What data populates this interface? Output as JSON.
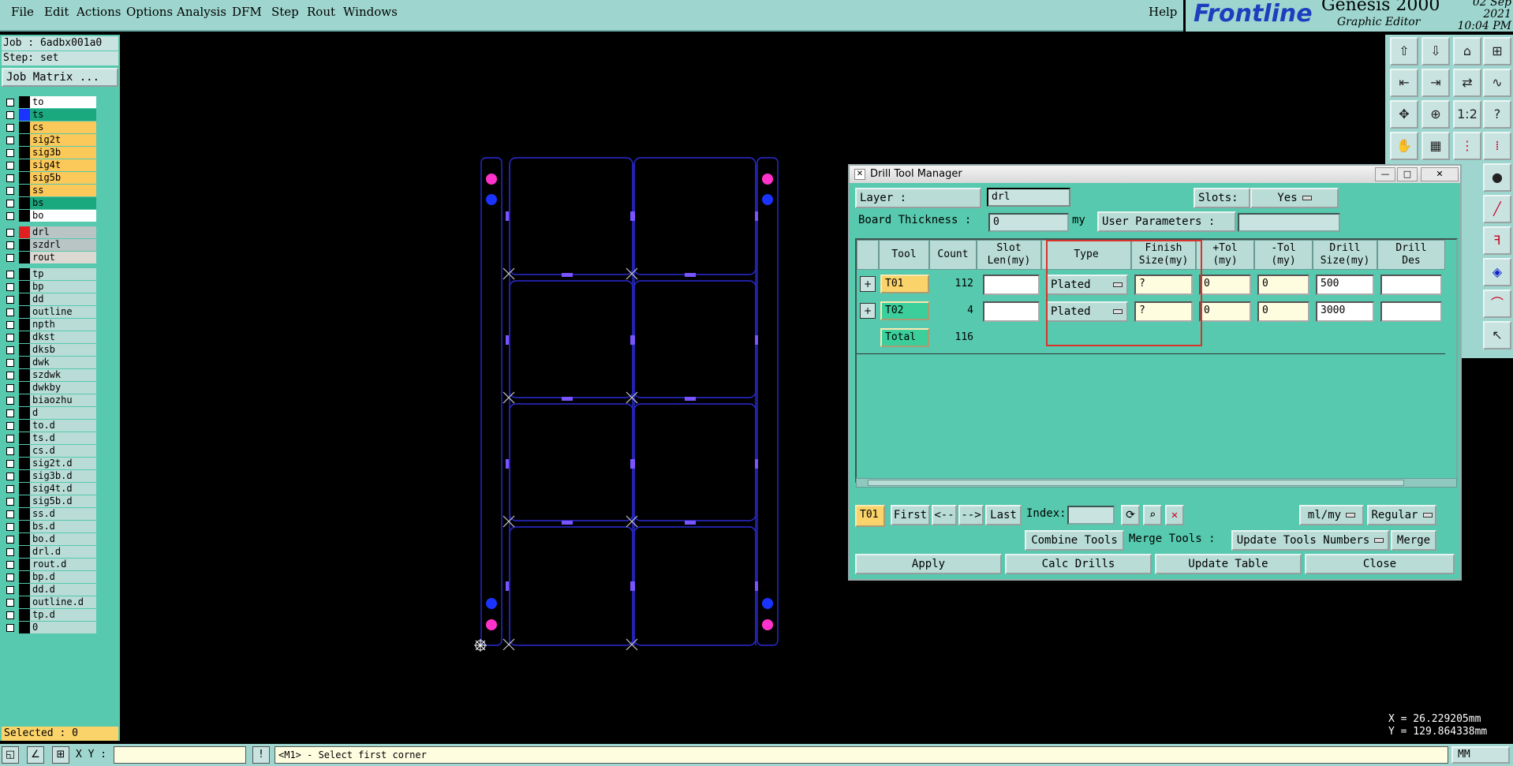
{
  "menu": [
    "File",
    "Edit",
    "Actions",
    "Options",
    "Analysis",
    "DFM",
    "Step",
    "Rout",
    "Windows"
  ],
  "help": "Help",
  "brand": {
    "logo": "Frontline",
    "product": "Genesis 2000",
    "subtitle": "Graphic Editor",
    "date": "02 Sep 2021",
    "time": "10:04 PM"
  },
  "left": {
    "job": "Job : 6adbx001a0",
    "step": "Step: set",
    "job_matrix": "Job Matrix ...",
    "layers_board": [
      {
        "name": "to",
        "color": "#ffffff"
      },
      {
        "name": "ts",
        "color": "#1aa87e"
      },
      {
        "name": "cs",
        "color": "#fbc85a"
      },
      {
        "name": "sig2t",
        "color": "#fbc85a"
      },
      {
        "name": "sig3b",
        "color": "#fbc85a"
      },
      {
        "name": "sig4t",
        "color": "#fbc85a"
      },
      {
        "name": "sig5b",
        "color": "#fbc85a"
      },
      {
        "name": "ss",
        "color": "#fbc85a"
      },
      {
        "name": "bs",
        "color": "#1aa87e"
      },
      {
        "name": "bo",
        "color": "#ffffff"
      }
    ],
    "layers_drill": [
      {
        "name": "drl",
        "color": "#b9c4c4"
      },
      {
        "name": "szdrl",
        "color": "#b9c4c4"
      },
      {
        "name": "rout",
        "color": "#dcd8d2"
      }
    ],
    "layers_misc": [
      "tp",
      "bp",
      "dd",
      "outline",
      "npth",
      "dkst",
      "dksb",
      "dwk",
      "szdwk",
      "dwkby",
      "biaozhu",
      "d",
      "to.d",
      "ts.d",
      "cs.d",
      "sig2t.d",
      "sig3b.d",
      "sig4t.d",
      "sig5b.d",
      "ss.d",
      "bs.d",
      "bo.d",
      "drl.d",
      "rout.d",
      "bp.d",
      "dd.d",
      "outline.d",
      "tp.d",
      "0"
    ],
    "selected": "Selected : 0"
  },
  "right_tools": [
    "up-arrow-icon",
    "down-arrow-icon",
    "home-icon",
    "grid-icon",
    "left-icon",
    "right-icon",
    "swap-icon",
    "wave-icon",
    "fit-icon",
    "zoom-icon",
    "ratio-label",
    "help-icon",
    "hand-icon",
    "grid2-icon",
    "snap-icon",
    "snap2-icon"
  ],
  "ratio_label": "1:2",
  "help_q": "?",
  "coords": {
    "x": "X = 26.229205mm",
    "y": "Y = 129.864338mm"
  },
  "bottom": {
    "xy_label": "X Y :",
    "message": "<M1> - Select first corner",
    "unit": "MM"
  },
  "dialog": {
    "title": "Drill Tool Manager",
    "layer_label": "Layer          :",
    "layer_value": "drl",
    "slots_label": "Slots:",
    "slots_value": "Yes",
    "board_thickness_label": "Board Thickness :",
    "board_thickness_value": "0",
    "board_thickness_unit": "my",
    "user_params_label": "User Parameters :",
    "columns": [
      "Tool",
      "Count",
      "Slot\nLen(my)",
      "Type",
      "Finish\nSize(my)",
      "+Tol\n(my)",
      "-Tol\n(my)",
      "Drill\nSize(my)",
      "Drill\nDes"
    ],
    "rows": [
      {
        "tool": "T01",
        "count": "112",
        "slot_len": "",
        "type": "Plated",
        "finish": "?",
        "ptol": "0",
        "ntol": "0",
        "drill_size": "500",
        "drill_des": ""
      },
      {
        "tool": "T02",
        "count": "4",
        "slot_len": "",
        "type": "Plated",
        "finish": "?",
        "ptol": "0",
        "ntol": "0",
        "drill_size": "3000",
        "drill_des": ""
      }
    ],
    "total_label": "Total",
    "total_count": "116",
    "nav": {
      "current": "T01",
      "first": "First",
      "prev": "<--",
      "next": "-->",
      "last": "Last",
      "index_label": "Index:",
      "units": "ml/my",
      "mode": "Regular"
    },
    "combine_tools": "Combine Tools",
    "merge_tools_label": "Merge Tools :",
    "update_tools_numbers": "Update Tools Numbers",
    "merge": "Merge",
    "apply": "Apply",
    "calc_drills": "Calc Drills",
    "update_table": "Update Table",
    "close": "Close"
  }
}
